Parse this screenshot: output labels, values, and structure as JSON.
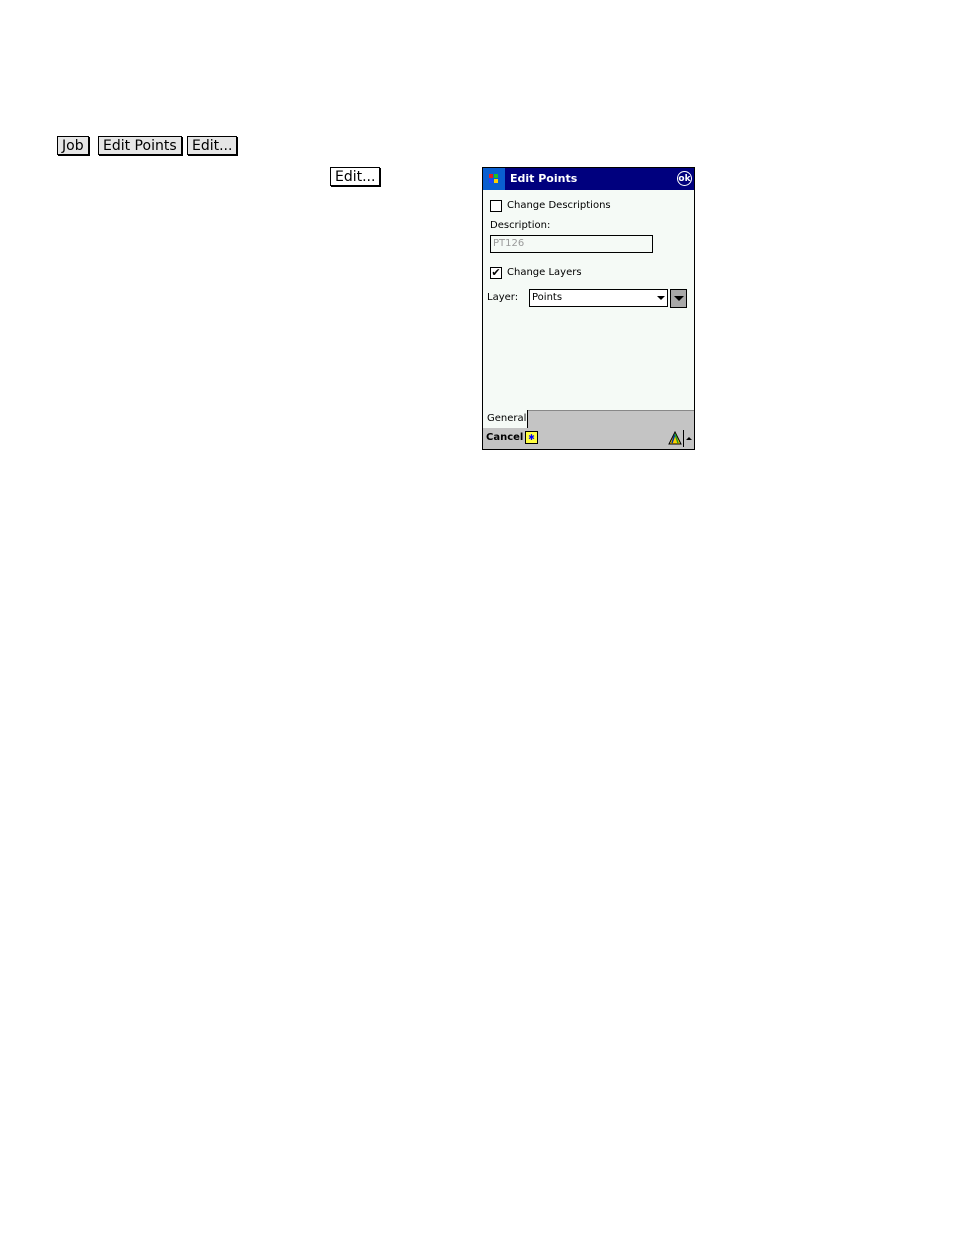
{
  "breadcrumb": [
    "Job",
    "Edit Points",
    "Edit..."
  ],
  "inline_button": "Edit...",
  "dialog": {
    "title": "Edit Points",
    "ok_label": "ok",
    "change_descriptions": {
      "label": "Change Descriptions",
      "checked": false
    },
    "description_label": "Description:",
    "description_value": "PT126",
    "change_layers": {
      "label": "Change Layers",
      "checked": true,
      "mark": "✔"
    },
    "layer_label": "Layer:",
    "layer_value": "Points",
    "tabs": [
      "General"
    ],
    "cancel_label": "Cancel",
    "sip_glyph": "✱",
    "colors": {
      "titlebar": "#00007e",
      "body": "#f5faf6",
      "cmdbar": "#c4c4c4"
    }
  }
}
